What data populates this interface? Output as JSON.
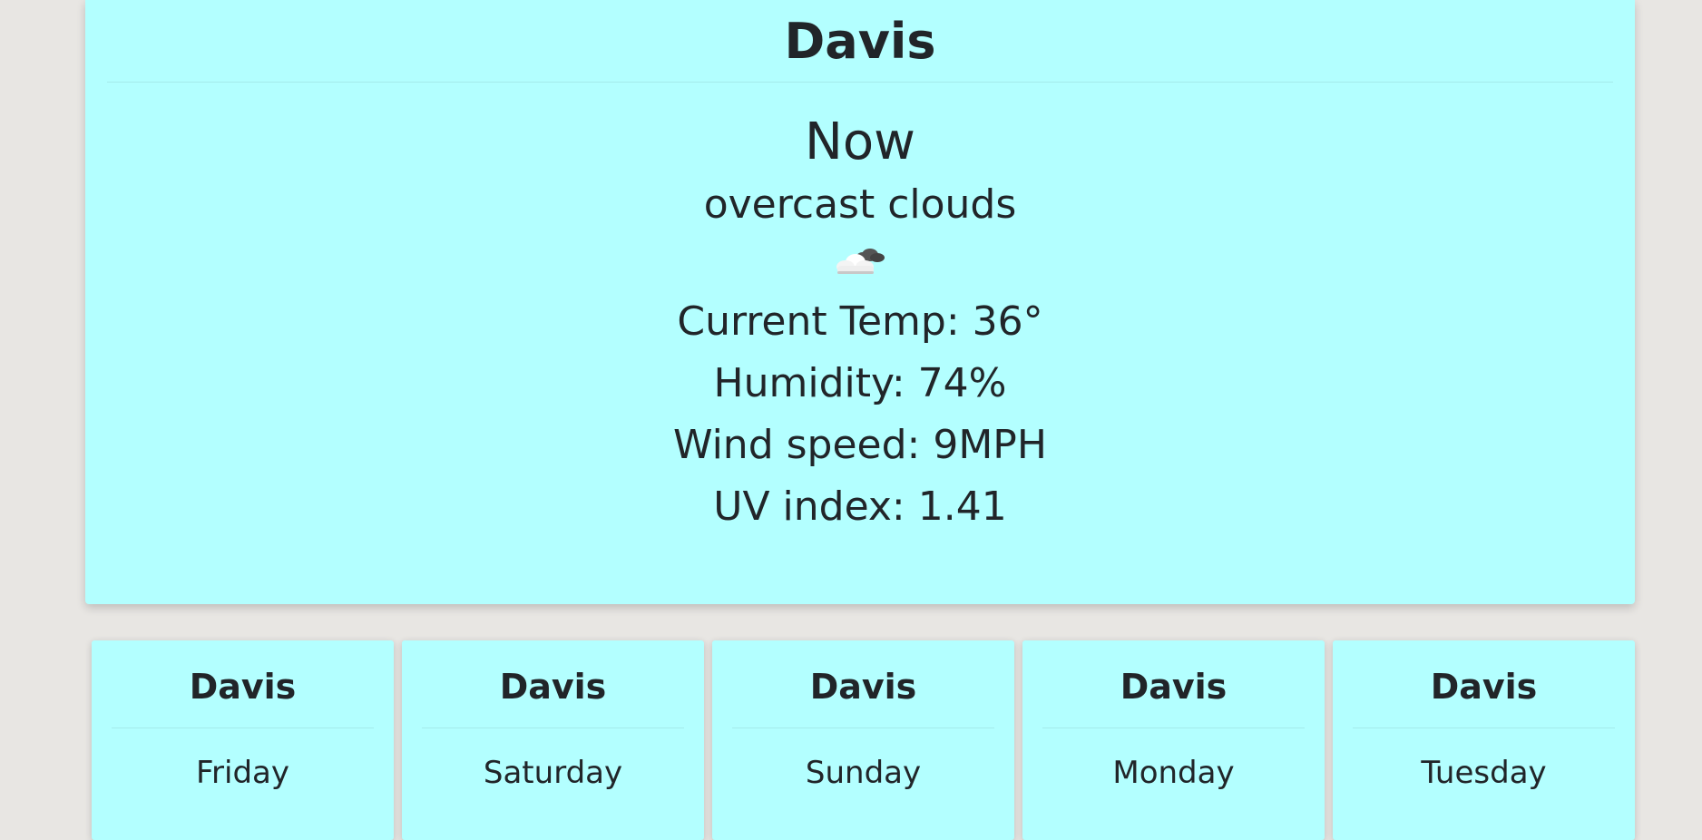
{
  "current": {
    "city": "Davis",
    "heading": "Now",
    "condition": "overcast clouds",
    "icon": "overcast-clouds-icon",
    "stats": {
      "temp": "Current Temp: 36°",
      "humidity": "Humidity: 74%",
      "wind": "Wind speed: 9MPH",
      "uv": "UV index: 1.41"
    }
  },
  "forecast": [
    {
      "city": "Davis",
      "day": "Friday"
    },
    {
      "city": "Davis",
      "day": "Saturday"
    },
    {
      "city": "Davis",
      "day": "Sunday"
    },
    {
      "city": "Davis",
      "day": "Monday"
    },
    {
      "city": "Davis",
      "day": "Tuesday"
    }
  ],
  "colors": {
    "card_background": "#b3ffff",
    "page_background": "#e8e6e3",
    "text": "#212529"
  }
}
